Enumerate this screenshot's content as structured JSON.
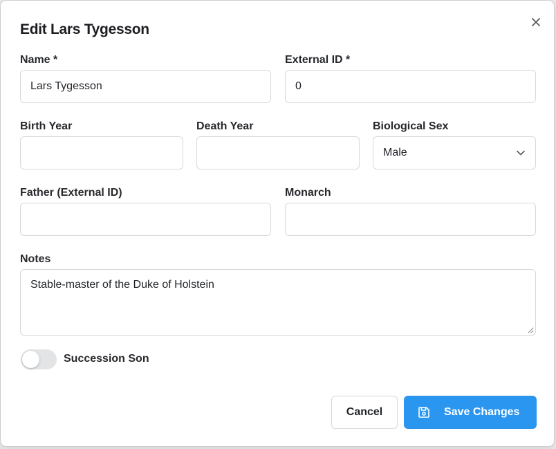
{
  "dialog": {
    "title": "Edit Lars Tygesson",
    "close_icon": "close-icon"
  },
  "form": {
    "name": {
      "label": "Name *",
      "value": "Lars Tygesson"
    },
    "external_id": {
      "label": "External ID *",
      "value": "0"
    },
    "birth_year": {
      "label": "Birth Year",
      "value": ""
    },
    "death_year": {
      "label": "Death Year",
      "value": ""
    },
    "biological_sex": {
      "label": "Biological Sex",
      "value": "Male",
      "icon": "chevron-down-icon"
    },
    "father": {
      "label": "Father (External ID)",
      "value": ""
    },
    "monarch": {
      "label": "Monarch",
      "value": ""
    },
    "notes": {
      "label": "Notes",
      "value": "Stable-master of the Duke of Holstein"
    },
    "succession_son": {
      "label": "Succession Son",
      "checked": false
    }
  },
  "actions": {
    "cancel_label": "Cancel",
    "save_label": "Save Changes",
    "save_icon": "save-icon",
    "accent_color": "#2b96f0"
  }
}
